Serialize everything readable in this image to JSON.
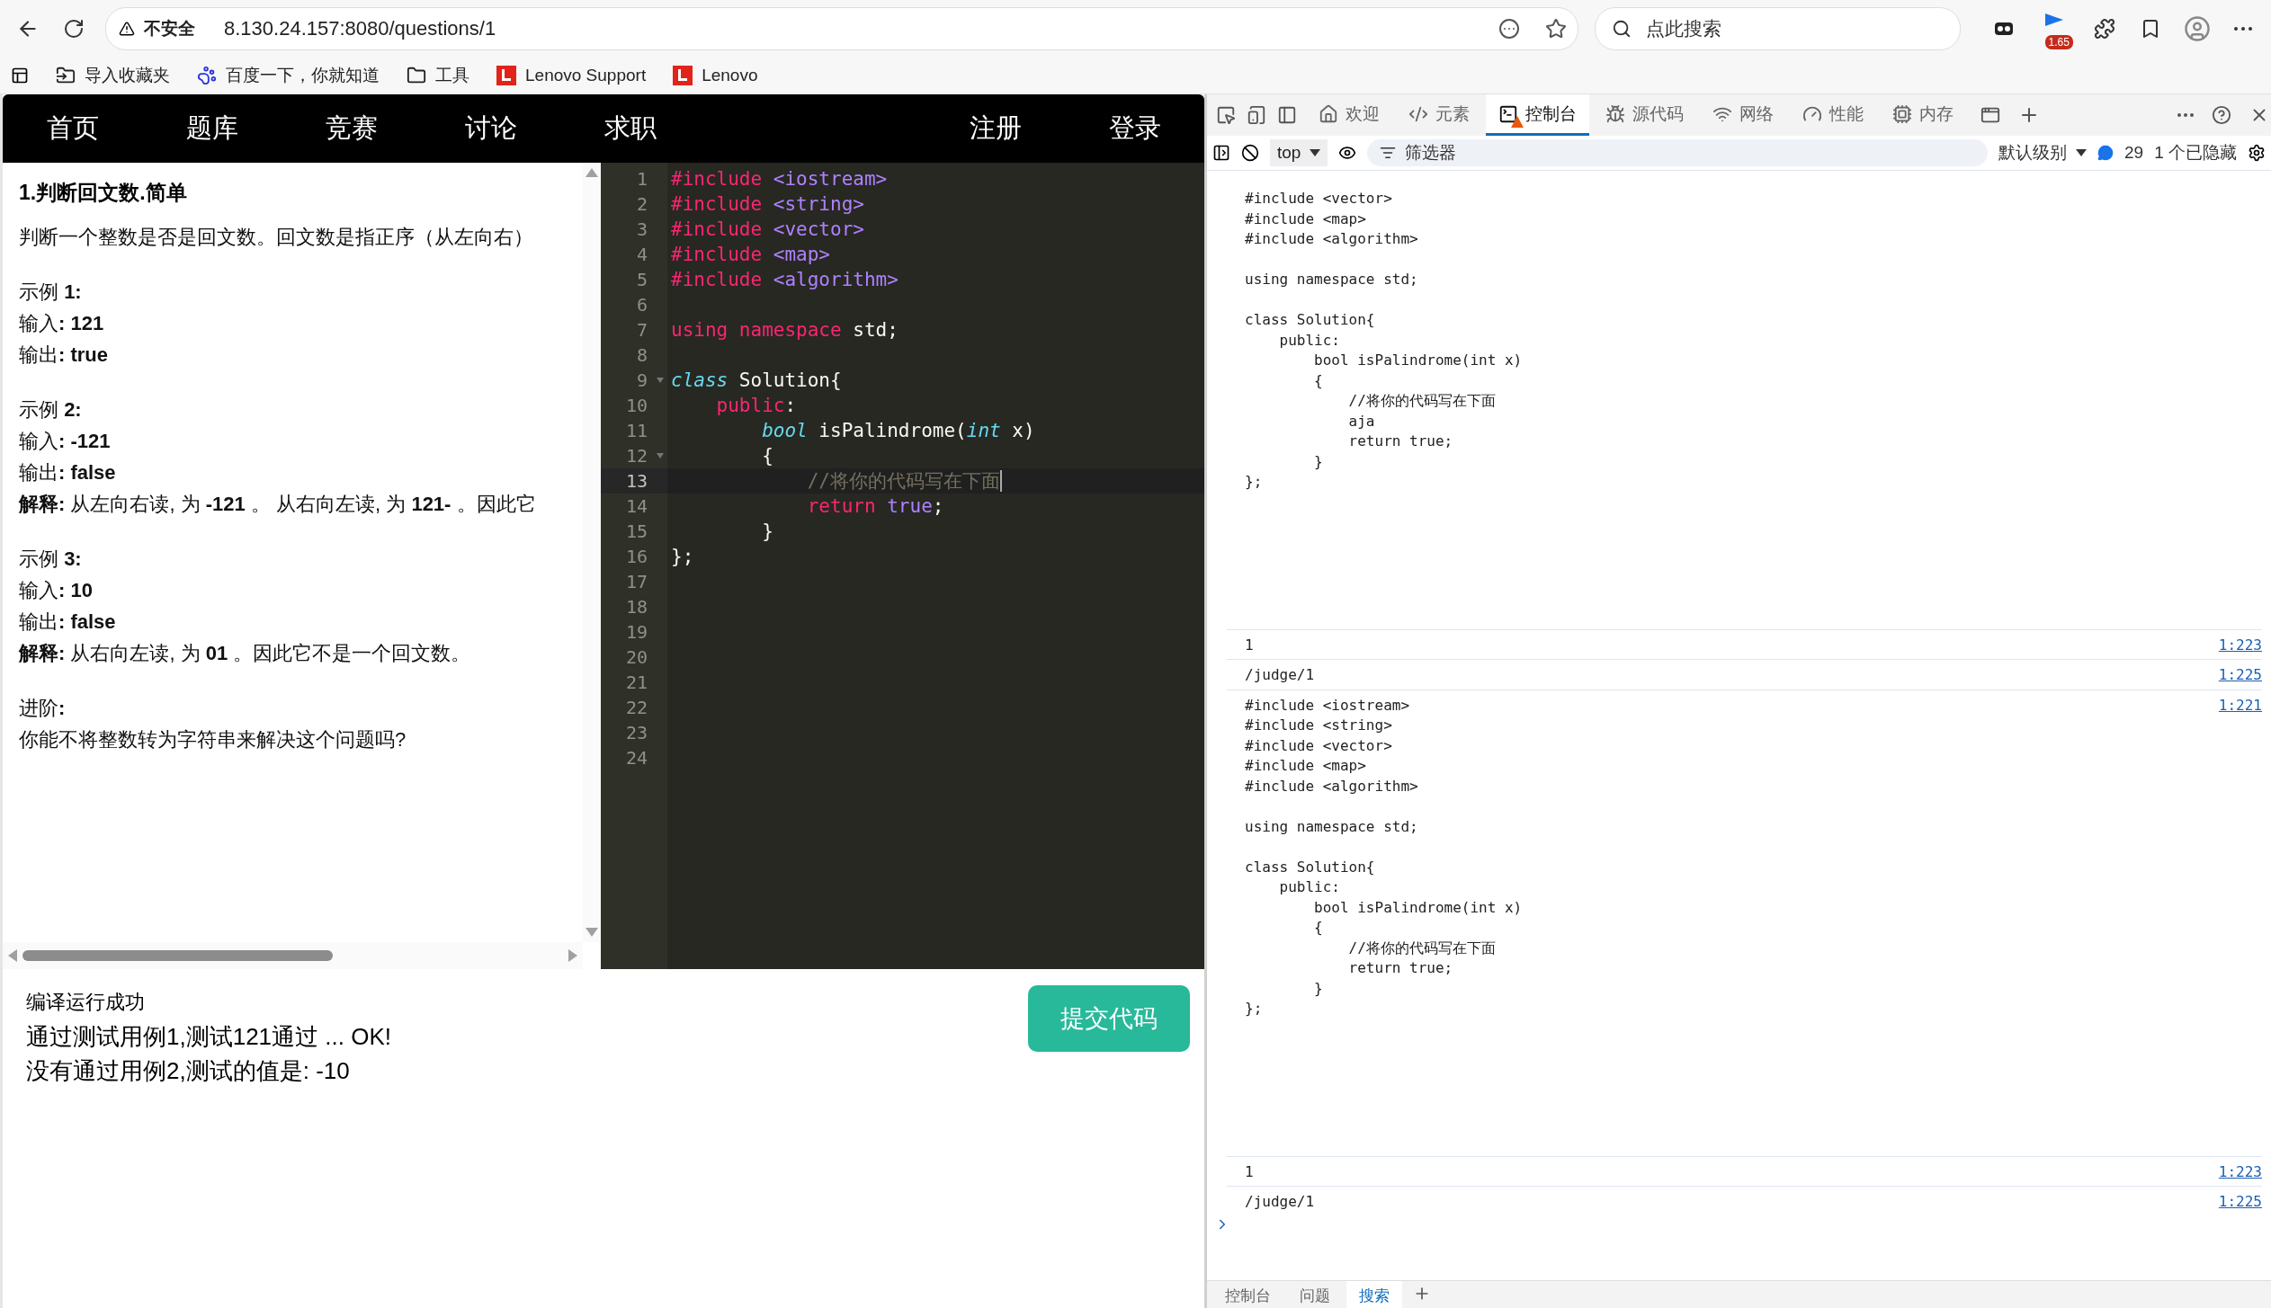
{
  "browser": {
    "security_label": "不安全",
    "url": "8.130.24.157:8080/questions/1",
    "search_placeholder": "点此搜索",
    "extension_badge": "1.65",
    "bookmarks": [
      {
        "kind": "import",
        "label": "导入收藏夹"
      },
      {
        "kind": "baidu",
        "label": "百度一下，你就知道"
      },
      {
        "kind": "folder",
        "label": "工具"
      },
      {
        "kind": "lenovo",
        "label": "Lenovo Support"
      },
      {
        "kind": "lenovo",
        "label": "Lenovo"
      }
    ]
  },
  "site_nav": {
    "left": [
      "首页",
      "题库",
      "竞赛",
      "讨论",
      "求职"
    ],
    "right": [
      "注册",
      "登录"
    ]
  },
  "problem": {
    "title": "1.判断回文数.简单",
    "blocks": [
      [
        "判断一个整数是否是回文数。回文数是指正序（从左向右）"
      ],
      [
        "示例 **1:**",
        "输入**: 121**",
        "输出**: true**"
      ],
      [
        "示例 **2:**",
        "输入**: -121**",
        "输出**: false**",
        "**解释:** 从左向右读, 为 **-121** 。 从右向左读, 为 **121-** 。因此它"
      ],
      [
        "示例 **3:**",
        "输入**: 10**",
        "输出**: false**",
        "**解释:** 从右向左读, 为 **01** 。因此它不是一个回文数。"
      ],
      [
        "进阶**:**",
        "你能不将整数转为字符串来解决这个问题吗?"
      ]
    ]
  },
  "editor": {
    "lines": [
      {
        "n": "1",
        "active": false,
        "foldable": false,
        "tokens": [
          {
            "kind": "keyword",
            "text": "#include"
          },
          {
            "kind": "constant",
            "text": " <iostream>"
          }
        ]
      },
      {
        "n": "2",
        "active": false,
        "foldable": false,
        "tokens": [
          {
            "kind": "keyword",
            "text": "#include"
          },
          {
            "kind": "constant",
            "text": " <string>"
          }
        ]
      },
      {
        "n": "3",
        "active": false,
        "foldable": false,
        "tokens": [
          {
            "kind": "keyword",
            "text": "#include"
          },
          {
            "kind": "constant",
            "text": " <vector>"
          }
        ]
      },
      {
        "n": "4",
        "active": false,
        "foldable": false,
        "tokens": [
          {
            "kind": "keyword",
            "text": "#include"
          },
          {
            "kind": "constant",
            "text": " <map>"
          }
        ]
      },
      {
        "n": "5",
        "active": false,
        "foldable": false,
        "tokens": [
          {
            "kind": "keyword",
            "text": "#include"
          },
          {
            "kind": "constant",
            "text": " <algorithm>"
          }
        ]
      },
      {
        "n": "6",
        "active": false,
        "foldable": false
      },
      {
        "n": "7",
        "active": false,
        "foldable": false,
        "tokens": [
          {
            "kind": "keyword",
            "text": "using namespace"
          },
          {
            "kind": "plain",
            "text": " std;"
          }
        ]
      },
      {
        "n": "8",
        "active": false,
        "foldable": false
      },
      {
        "n": "9",
        "active": false,
        "foldable": true,
        "tokens": [
          {
            "kind": "type",
            "text": "class"
          },
          {
            "kind": "plain",
            "text": " Solution{"
          }
        ]
      },
      {
        "n": "10",
        "active": false,
        "foldable": false,
        "tokens": [
          {
            "kind": "keyword",
            "text": "    public"
          },
          {
            "kind": "plain",
            "text": ":"
          }
        ]
      },
      {
        "n": "11",
        "active": false,
        "foldable": false,
        "tokens": [
          {
            "kind": "type",
            "text": "        bool"
          },
          {
            "kind": "plain",
            "text": " isPalindrome("
          },
          {
            "kind": "type",
            "text": "int"
          },
          {
            "kind": "plain",
            "text": " x)"
          }
        ]
      },
      {
        "n": "12",
        "active": false,
        "foldable": true,
        "tokens": [
          {
            "kind": "plain",
            "text": "        {"
          }
        ]
      },
      {
        "n": "13",
        "active": true,
        "foldable": false,
        "tokens": [
          {
            "kind": "comment",
            "text": "            //将你的代码写在下面"
          }
        ]
      },
      {
        "n": "14",
        "active": false,
        "foldable": false,
        "tokens": [
          {
            "kind": "keyword",
            "text": "            return"
          },
          {
            "kind": "constant",
            "text": " true"
          },
          {
            "kind": "plain",
            "text": ";"
          }
        ]
      },
      {
        "n": "15",
        "active": false,
        "foldable": false,
        "tokens": [
          {
            "kind": "plain",
            "text": "        }"
          }
        ]
      },
      {
        "n": "16",
        "active": false,
        "foldable": false,
        "tokens": [
          {
            "kind": "plain",
            "text": "};"
          }
        ]
      },
      {
        "n": "17",
        "active": false,
        "foldable": false
      },
      {
        "n": "18",
        "active": false,
        "foldable": false
      },
      {
        "n": "19",
        "active": false,
        "foldable": false
      },
      {
        "n": "20",
        "active": false,
        "foldable": false
      },
      {
        "n": "21",
        "active": false,
        "foldable": false
      },
      {
        "n": "22",
        "active": false,
        "foldable": false
      },
      {
        "n": "23",
        "active": false,
        "foldable": false
      },
      {
        "n": "24",
        "active": false,
        "foldable": false
      }
    ]
  },
  "result": {
    "status": "编译运行成功",
    "lines": [
      "通过测试用例1,测试121通过 ... OK!",
      "没有通过用例2,测试的值是: -10"
    ]
  },
  "submit_button": "提交代码",
  "devtools": {
    "tabs": [
      {
        "kind": "home",
        "label": "欢迎",
        "selected": false,
        "warning": false
      },
      {
        "kind": "code",
        "label": "元素",
        "selected": false,
        "warning": false
      },
      {
        "kind": "console",
        "label": "控制台",
        "selected": true,
        "warning": true
      },
      {
        "kind": "bug",
        "label": "源代码",
        "selected": false,
        "warning": false
      },
      {
        "kind": "wifi",
        "label": "网络",
        "selected": false,
        "warning": false
      },
      {
        "kind": "gauge",
        "label": "性能",
        "selected": false,
        "warning": false
      },
      {
        "kind": "chip",
        "label": "内存",
        "selected": false,
        "warning": false
      }
    ],
    "context": "top",
    "filter_placeholder": "筛选器",
    "level": "默认级别",
    "message_count": "29",
    "hidden_count": "1 个已隐藏",
    "messages": [
      {
        "kind": "code",
        "text": "#include <vector>\n#include <map>\n#include <algorithm>\n\nusing namespace std;\n\nclass Solution{\n    public:\n        bool isPalindrome(int x)\n        {\n            //将你的代码写在下面\n            aja\n            return true;\n        }\n};"
      },
      {
        "kind": "text",
        "text": "1",
        "source": "1:223"
      },
      {
        "kind": "text",
        "text": "/judge/1",
        "source": "1:225"
      },
      {
        "kind": "code",
        "text": "#include <iostream>\n#include <string>\n#include <vector>\n#include <map>\n#include <algorithm>\n\nusing namespace std;\n\nclass Solution{\n    public:\n        bool isPalindrome(int x)\n        {\n            //将你的代码写在下面\n            return true;\n        }\n};",
        "source": "1:221"
      },
      {
        "kind": "text",
        "text": "1",
        "source": "1:223"
      },
      {
        "kind": "text",
        "text": "/judge/1",
        "source": "1:225"
      }
    ],
    "drawer_tabs": [
      {
        "label": "控制台",
        "selected": false
      },
      {
        "label": "问题",
        "selected": false
      },
      {
        "label": "搜索",
        "selected": true
      }
    ]
  }
}
